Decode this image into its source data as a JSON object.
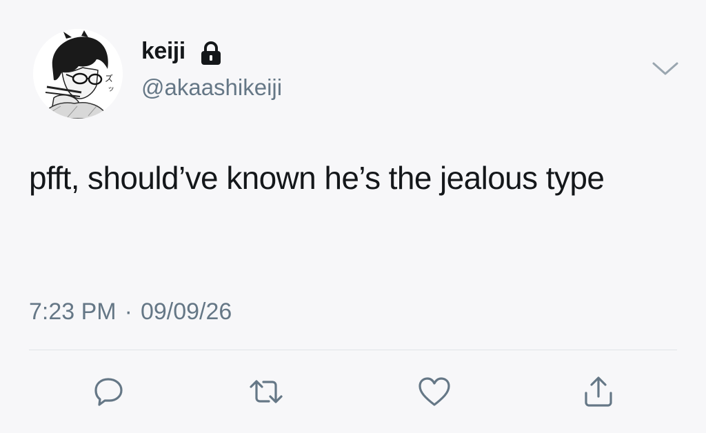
{
  "user": {
    "display_name": "keiji",
    "handle": "@akaashikeiji",
    "protected_icon": "lock-icon",
    "avatar_icon": "avatar-manga-glasses"
  },
  "tweet": {
    "text": "pfft, should’ve known he’s the jealous type",
    "time": "7:23 PM",
    "separator": "·",
    "date": "09/09/26"
  },
  "actions": [
    {
      "icon": "reply-icon"
    },
    {
      "icon": "retweet-icon"
    },
    {
      "icon": "like-icon"
    },
    {
      "icon": "share-icon"
    }
  ],
  "colors": {
    "background": "#f7f7f9",
    "text": "#14171a",
    "secondary": "#657786",
    "divider": "#dfe3e7"
  }
}
